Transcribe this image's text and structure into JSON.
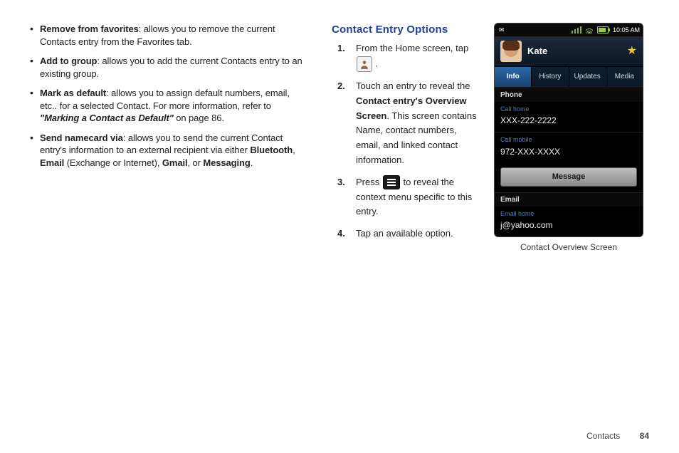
{
  "leftBullets": [
    {
      "term": "Remove from favorites",
      "desc": ": allows you to remove the current Contacts entry from the Favorites tab."
    },
    {
      "term": "Add to group",
      "desc": ": allows you to add the current Contacts entry to an existing group."
    },
    {
      "term": "Mark as default",
      "desc_pre": ": allows you to assign default numbers, email, etc.. for a selected Contact. For more information, refer to ",
      "desc_ref": "\"Marking a Contact as Default\"",
      "desc_post": "  on page 86."
    },
    {
      "term": "Send namecard via",
      "desc_pre": ": allows you to send the current Contact entry's information to an external recipient via either ",
      "b1": "Bluetooth",
      "sep1": ", ",
      "b2": "Email",
      "paren": " (Exchange or Internet), ",
      "b3": "Gmail",
      "sep2": ", or ",
      "b4": "Messaging",
      "tail": "."
    }
  ],
  "rightHeading": "Contact Entry Options",
  "steps": {
    "s1a": "From the Home screen, tap ",
    "s1b": ".",
    "s2a": "Touch an entry to reveal the ",
    "s2b": "Contact entry's Overview Screen",
    "s2c": ". This screen contains Name, contact numbers, email, and linked contact information.",
    "s3a": "Press ",
    "s3b": " to reveal the context menu specific to this entry.",
    "s4": "Tap an available option."
  },
  "phone": {
    "time": "10:05 AM",
    "name": "Kate",
    "tabs": [
      "Info",
      "History",
      "Updates",
      "Media"
    ],
    "sectionPhone": "Phone",
    "callHome": "Call home",
    "callHomeNum": "XXX-222-2222",
    "callMobile": "Call mobile",
    "callMobileNum": "972-XXX-XXXX",
    "messageBtn": "Message",
    "sectionEmail": "Email",
    "emailHome": "Email home",
    "emailVal": "j@yahoo.com"
  },
  "caption": "Contact Overview Screen",
  "footerSection": "Contacts",
  "footerPage": "84"
}
